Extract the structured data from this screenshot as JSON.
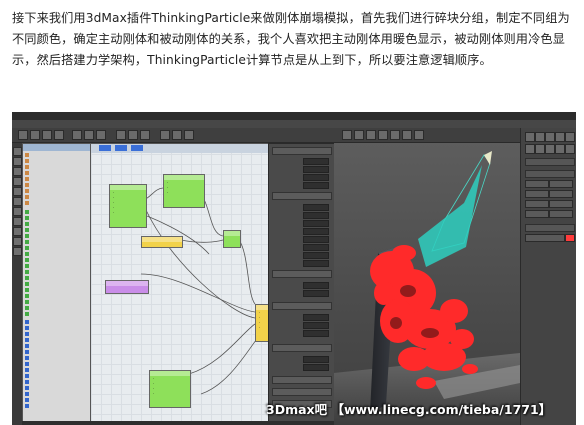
{
  "intro_text": "接下来我们用3dMax插件ThinkingParticle来做刚体崩塌模拟，首先我们进行碎块分组，制定不同组为不同颜色，确定主动刚体和被动刚体的关系，我个人喜欢把主动刚体用暖色显示，被动刚体则用冷色显示，然后搭建力学架构，ThinkingParticle计算节点是从上到下，所以要注意逻辑顺序。",
  "watermark": "3Dmax吧 【www.linecg.com/tieba/1771】",
  "colors": {
    "node_green": "#8ee05a",
    "node_yellow": "#f2d24a",
    "node_purple": "#c98de8",
    "active_rigid_warm": "#ff2a2a",
    "passive_rigid_cool": "#3fd6c0",
    "viewport_bg": "#4d4d4d"
  }
}
